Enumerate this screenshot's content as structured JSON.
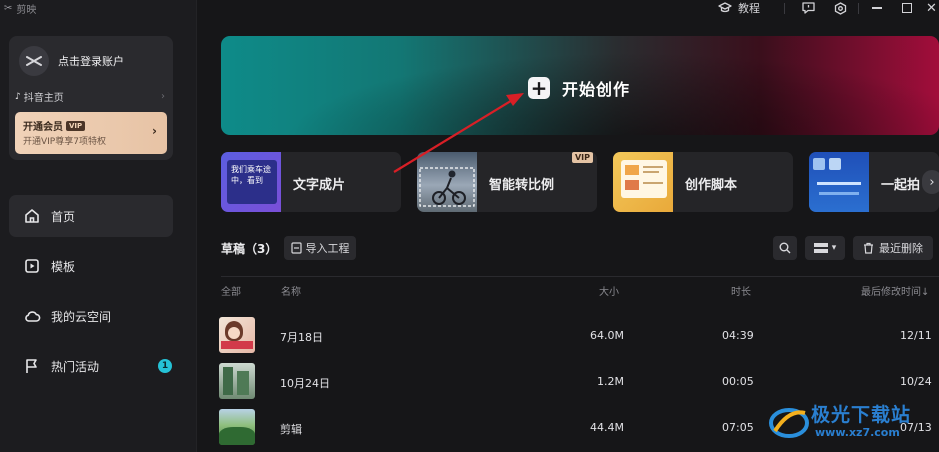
{
  "app": {
    "name": "剪映"
  },
  "titlebar": {
    "tutorial": "教程"
  },
  "account": {
    "login": "点击登录账户",
    "douyin": "抖音主页",
    "vip_title": "开通会员",
    "vip_tag": "VIP",
    "vip_sub": "开通VIP尊享7项特权"
  },
  "nav": [
    {
      "label": "首页",
      "icon": "home-icon",
      "active": true
    },
    {
      "label": "模板",
      "icon": "template-icon"
    },
    {
      "label": "我的云空间",
      "icon": "cloud-icon"
    },
    {
      "label": "热门活动",
      "icon": "flag-icon",
      "badge": "1"
    }
  ],
  "hero": {
    "label": "开始创作"
  },
  "features": [
    {
      "label": "文字成片",
      "thumb_text": "我们乘车途中，看到"
    },
    {
      "label": "智能转比例",
      "vip": "VIP"
    },
    {
      "label": "创作脚本"
    },
    {
      "label": "一起拍"
    }
  ],
  "drafts": {
    "title": "草稿（3）",
    "import": "导入工程",
    "recent_delete": "最近删除",
    "columns": {
      "all": "全部",
      "name": "名称",
      "size": "大小",
      "duration": "时长",
      "modified": "最后修改时间↓"
    },
    "rows": [
      {
        "name": "7月18日",
        "size": "64.0M",
        "duration": "04:39",
        "modified": "12/11"
      },
      {
        "name": "10月24日",
        "size": "1.2M",
        "duration": "00:05",
        "modified": "10/24"
      },
      {
        "name": "剪辑",
        "size": "44.4M",
        "duration": "07:05",
        "modified": "07/13"
      }
    ]
  },
  "watermark": {
    "text": "极光下载站",
    "url": "www.xz7.com"
  }
}
